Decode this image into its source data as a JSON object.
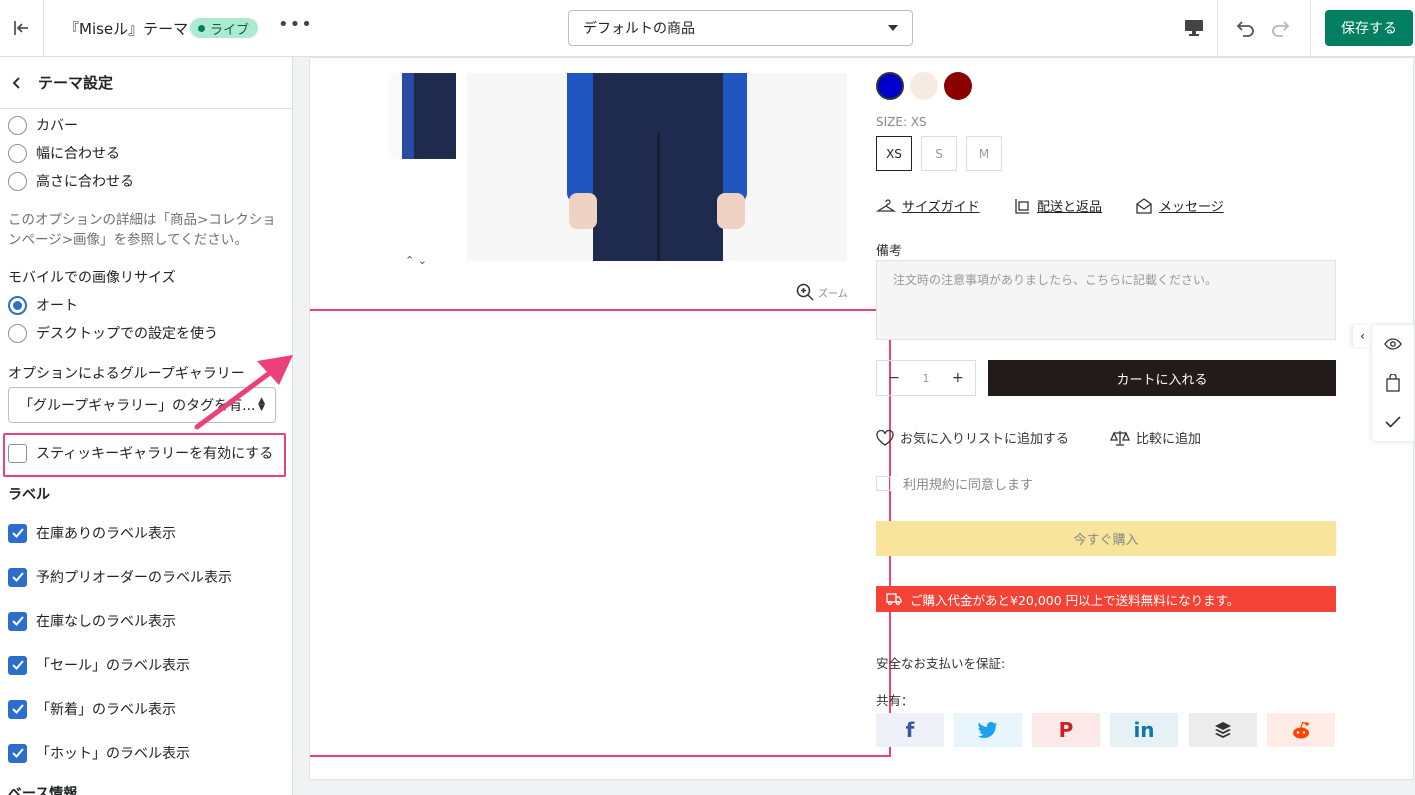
{
  "topbar": {
    "theme_name": "『Miseル』テーマ",
    "live_badge": "ライブ",
    "more": "•••",
    "page_select_value": "デフォルトの商品",
    "save_label": "保存する"
  },
  "sidebar": {
    "title": "テーマ設定",
    "fit_options": [
      {
        "label": "カバー",
        "selected": false
      },
      {
        "label": "幅に合わせる",
        "selected": false
      },
      {
        "label": "高さに合わせる",
        "selected": false
      }
    ],
    "help_text": "このオプションの詳細は「商品>コレクションページ>画像」を参照してください。",
    "mobile_resize_label": "モバイルでの画像リサイズ",
    "mobile_options": [
      {
        "label": "オート",
        "selected": true
      },
      {
        "label": "デスクトップでの設定を使う",
        "selected": false
      }
    ],
    "group_gallery_label": "オプションによるグループギャラリー",
    "group_gallery_value": "「グループギャラリー」のタグを有...",
    "sticky_gallery_label": "スティッキーギャラリーを有効にする",
    "labels_heading": "ラベル",
    "label_checks": [
      {
        "label": "在庫ありのラベル表示",
        "checked": true
      },
      {
        "label": "予約プリオーダーのラベル表示",
        "checked": true
      },
      {
        "label": "在庫なしのラベル表示",
        "checked": true
      },
      {
        "label": "「セール」のラベル表示",
        "checked": true
      },
      {
        "label": "「新着」のラベル表示",
        "checked": true
      },
      {
        "label": "「ホット」のラベル表示",
        "checked": true
      }
    ],
    "next_heading": "ベース情報"
  },
  "preview": {
    "thumb_nav": "⌃ ⌄",
    "zoom_label": "ズーム",
    "swatch_colors": [
      "#0000cc",
      "#f7ebe1",
      "#8b0000"
    ],
    "size_label": "SIZE: XS",
    "sizes": [
      {
        "label": "XS",
        "selected": true
      },
      {
        "label": "S",
        "selected": false
      },
      {
        "label": "M",
        "selected": false
      }
    ],
    "links": {
      "size_guide": "サイズガイド",
      "shipping": "配送と返品",
      "message": "メッセージ"
    },
    "note_label": "備考",
    "note_placeholder": "注文時の注意事項がありましたら、こちらに記載ください。",
    "qty_minus": "−",
    "qty_value": "1",
    "qty_plus": "+",
    "add_to_cart": "カートに入れる",
    "wishlist": "お気に入りリストに追加する",
    "compare": "比較に追加",
    "agree_terms": "利用規約に同意します",
    "buy_now": "今すぐ購入",
    "free_shipping": "ご購入代金があと¥20,000 円以上で送料無料になります。",
    "secure_payment": "安全なお支払いを保証:",
    "share_label": "共有：",
    "share_buttons": [
      {
        "glyph": "f",
        "color": "#3b5998",
        "bg": "#eef1f7"
      },
      {
        "glyph": "",
        "color": "#1da1f2",
        "bg": "#e8f5fd"
      },
      {
        "glyph": "P",
        "color": "#cb2027",
        "bg": "#fbe9ea"
      },
      {
        "glyph": "in",
        "color": "#0e76a8",
        "bg": "#e6f1f6"
      },
      {
        "glyph": "",
        "color": "#333333",
        "bg": "#ececec"
      },
      {
        "glyph": "",
        "color": "#ff4500",
        "bg": "#ffece6"
      }
    ]
  },
  "accent_colors": {
    "save": "#008060",
    "highlight": "#ec407a",
    "checkbox": "#2c6ecb"
  }
}
